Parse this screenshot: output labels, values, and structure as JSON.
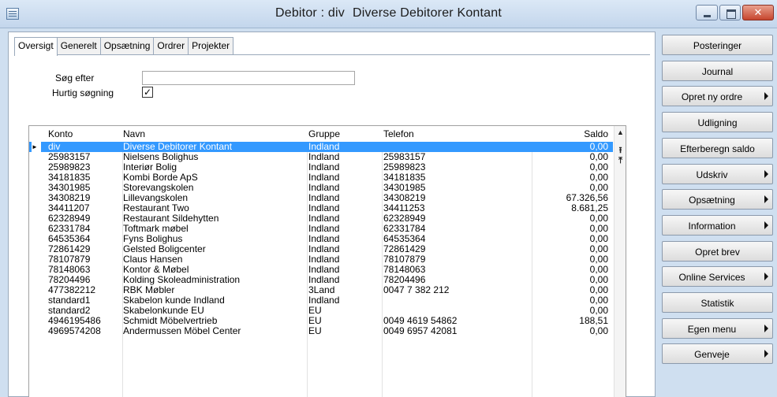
{
  "window": {
    "title_prefix": "Debitor : div",
    "title_name": "Diverse Debitorer Kontant"
  },
  "tabs": [
    "Oversigt",
    "Generelt",
    "Opsætning",
    "Ordrer",
    "Projekter"
  ],
  "search": {
    "label": "Søg efter",
    "value": "",
    "quick_label": "Hurtig søgning",
    "quick_checked": "✓"
  },
  "grid": {
    "headers": [
      "Konto",
      "Navn",
      "Gruppe",
      "Telefon",
      "Saldo"
    ],
    "rows": [
      [
        "div",
        "Diverse Debitorer Kontant",
        "Indland",
        "",
        "0,00"
      ],
      [
        "25983157",
        "Nielsens Bolighus",
        "Indland",
        "25983157",
        "0,00"
      ],
      [
        "25989823",
        "Interiør Bolig",
        "Indland",
        "25989823",
        "0,00"
      ],
      [
        "34181835",
        "Kombi Borde ApS",
        "Indland",
        "34181835",
        "0,00"
      ],
      [
        "34301985",
        "Storevangskolen",
        "Indland",
        "34301985",
        "0,00"
      ],
      [
        "34308219",
        "Lillevangskolen",
        "Indland",
        "34308219",
        "67.326,56"
      ],
      [
        "34411207",
        "Restaurant Two",
        "Indland",
        "34411253",
        "8.681,25"
      ],
      [
        "62328949",
        "Restaurant Sildehytten",
        "Indland",
        "62328949",
        "0,00"
      ],
      [
        "62331784",
        "Toftmark møbel",
        "Indland",
        "62331784",
        "0,00"
      ],
      [
        "64535364",
        "Fyns Bolighus",
        "Indland",
        "64535364",
        "0,00"
      ],
      [
        "72861429",
        "Gelsted Boligcenter",
        "Indland",
        "72861429",
        "0,00"
      ],
      [
        "78107879",
        "Claus Hansen",
        "Indland",
        "78107879",
        "0,00"
      ],
      [
        "78148063",
        "Kontor & Møbel",
        "Indland",
        "78148063",
        "0,00"
      ],
      [
        "78204496",
        "Kolding Skoleadministration",
        "Indland",
        "78204496",
        "0,00"
      ],
      [
        "477382212",
        "RBK  Møbler",
        "3Land",
        "0047 7 382 212",
        "0,00"
      ],
      [
        "standard1",
        "Skabelon kunde Indland",
        "Indland",
        "",
        "0,00"
      ],
      [
        "standard2",
        "Skabelonkunde EU",
        "EU",
        "",
        "0,00"
      ],
      [
        "4946195486",
        "Schmidt Möbelvertrieb",
        "EU",
        "0049 4619 54862",
        "188,51"
      ],
      [
        "4969574208",
        "Andermussen Möbel Center",
        "EU",
        "0049 6957 42081",
        "0,00"
      ]
    ],
    "selected_indicator": "►"
  },
  "sidebar": [
    {
      "label": "Posteringer",
      "submenu": false
    },
    {
      "label": "Journal",
      "submenu": false
    },
    {
      "label": "Opret ny ordre",
      "submenu": true
    },
    {
      "label": "Udligning",
      "submenu": false
    },
    {
      "label": "Efterberegn saldo",
      "submenu": false
    },
    {
      "label": "Udskriv",
      "submenu": true
    },
    {
      "label": "Opsætning",
      "submenu": true
    },
    {
      "label": "Information",
      "submenu": true
    },
    {
      "label": "Opret brev",
      "submenu": false
    },
    {
      "label": "Online Services",
      "submenu": true
    },
    {
      "label": "Statistik",
      "submenu": false
    },
    {
      "label": "Egen menu",
      "submenu": true
    },
    {
      "label": "Genveje",
      "submenu": true
    }
  ]
}
